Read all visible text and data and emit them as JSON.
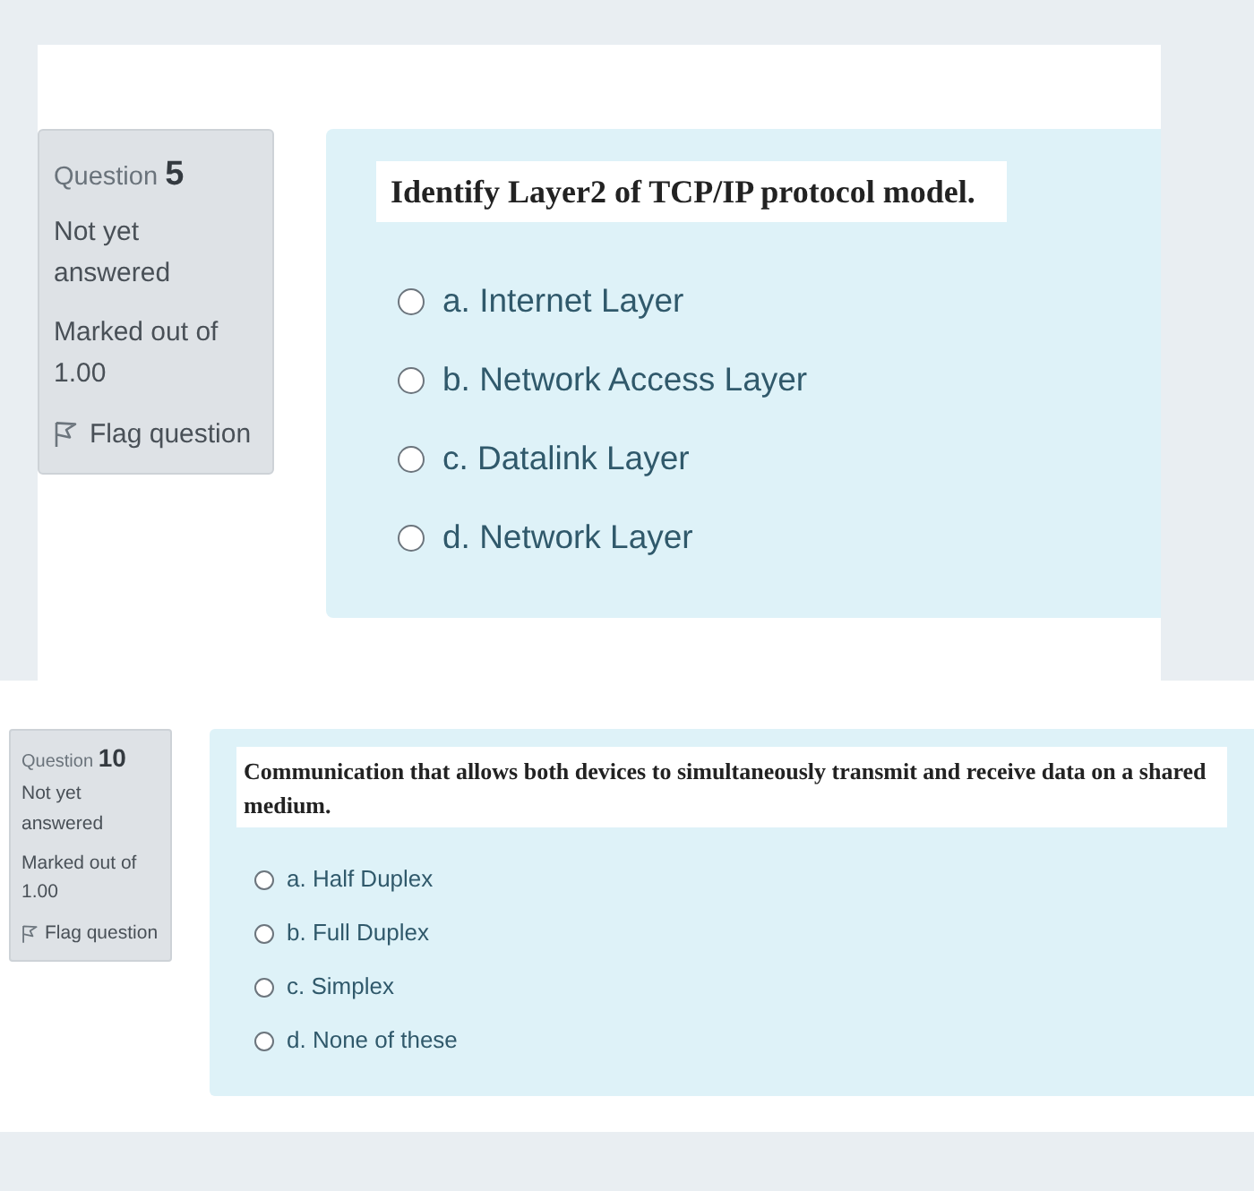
{
  "questions": [
    {
      "label": "Question",
      "number": "5",
      "status": "Not yet answered",
      "marked": "Marked out of 1.00",
      "flag": "Flag question",
      "text": "Identify Layer2 of TCP/IP protocol model.",
      "options": [
        {
          "label": "a. Internet Layer",
          "selected": false
        },
        {
          "label": "b. Network Access Layer",
          "selected": false
        },
        {
          "label": "c. Datalink Layer",
          "selected": false
        },
        {
          "label": "d. Network Layer",
          "selected": false
        }
      ]
    },
    {
      "label": "Question",
      "number": "10",
      "status": "Not yet answered",
      "marked": "Marked out of 1.00",
      "flag": "Flag question",
      "text": "Communication that allows both devices to simultaneously transmit and receive data on a shared medium.",
      "options": [
        {
          "label": "a. Half Duplex",
          "selected": false
        },
        {
          "label": "b. Full Duplex",
          "selected": false
        },
        {
          "label": "c. Simplex",
          "selected": false
        },
        {
          "label": "d. None of these",
          "selected": false
        }
      ]
    }
  ]
}
